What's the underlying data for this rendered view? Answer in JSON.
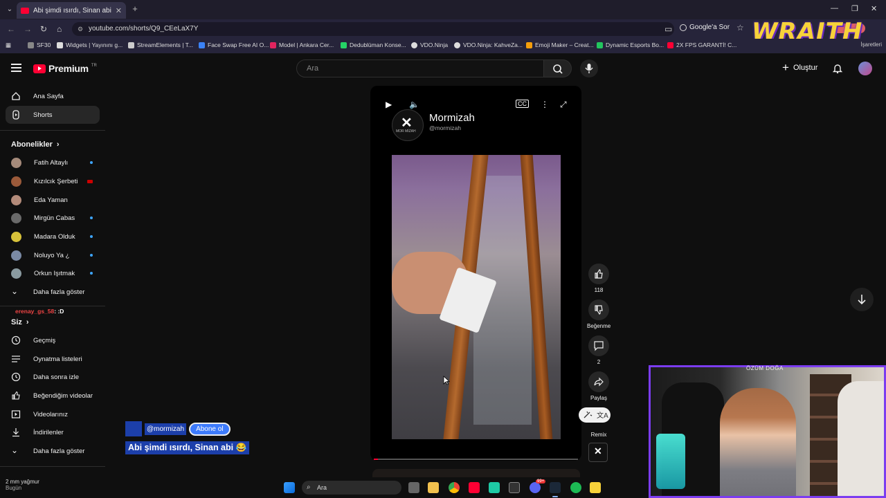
{
  "browser": {
    "tab_title": "Abi şimdi ısırdı, Sinan abi 😂 -",
    "url": "youtube.com/shorts/Q9_CEeLaX7Y",
    "google_sor": "Google'a Sor",
    "bookmarks": [
      {
        "label": "SF30",
        "color": "#888888"
      },
      {
        "label": "Widgets | Yayınını g...",
        "color": "#dddddd"
      },
      {
        "label": "StreamElements | T...",
        "color": "#cccccc"
      },
      {
        "label": "Face Swap Free AI O...",
        "color": "#3b82f6"
      },
      {
        "label": "Model | Ankara Cer...",
        "color": "#e0245e"
      },
      {
        "label": "Dedublüman Konse...",
        "color": "#25d366"
      },
      {
        "label": "VDO.Ninja",
        "color": "#dddddd"
      },
      {
        "label": "VDO.Ninja: KahveZa...",
        "color": "#dddddd"
      },
      {
        "label": "Emoji Maker – Creat...",
        "color": "#f59e0b"
      },
      {
        "label": "Dynamic Esports Bo...",
        "color": "#22c55e"
      },
      {
        "label": "2X FPS GARANTİ! C...",
        "color": "#ff0033"
      }
    ],
    "bookmarks_right": "İşaretleri",
    "overlay_logo": "WRAITH"
  },
  "header": {
    "brand": "Premium",
    "brand_sup": "TR",
    "search_placeholder": "Ara",
    "create_label": "Oluştur"
  },
  "sidebar": {
    "main": [
      {
        "label": "Ana Sayfa",
        "icon": "home-icon"
      },
      {
        "label": "Shorts",
        "icon": "shorts-icon",
        "active": true
      }
    ],
    "subscriptions_title": "Abonelikler",
    "subscriptions": [
      {
        "label": "Fatih Altaylı",
        "color": "#a58a7a",
        "indicator": "new"
      },
      {
        "label": "Kızılcık Şerbeti",
        "color": "#9b5a3a",
        "indicator": "live"
      },
      {
        "label": "Eda Yaman",
        "color": "#b38b7a",
        "indicator": "none"
      },
      {
        "label": "Mirgün Cabas",
        "color": "#6a6a6a",
        "indicator": "new"
      },
      {
        "label": "Madara Olduk",
        "color": "#d8c23a",
        "indicator": "new"
      },
      {
        "label": "Noluyo Ya ¿",
        "color": "#7a8aa5",
        "indicator": "new"
      },
      {
        "label": "Orkun Işıtmak",
        "color": "#8a9aa0",
        "indicator": "new"
      }
    ],
    "show_more": "Daha fazla göster",
    "chat_user": "erenay_gs_58",
    "chat_msg": ": :D",
    "you_title": "Siz",
    "you_items": [
      {
        "label": "Geçmiş",
        "icon": "history-icon"
      },
      {
        "label": "Oynatma listeleri",
        "icon": "playlist-icon"
      },
      {
        "label": "Daha sonra izle",
        "icon": "clock-icon"
      },
      {
        "label": "Beğendiğim videolar",
        "icon": "like-icon"
      },
      {
        "label": "Videolarınız",
        "icon": "video-icon"
      },
      {
        "label": "İndirilenler",
        "icon": "download-icon"
      }
    ],
    "show_more2": "Daha fazla göster"
  },
  "short": {
    "channel_name": "Mormizah",
    "channel_handle": "@mormizah",
    "logo_text": "MOR MİZAH",
    "likes": "118",
    "dislike_label": "Beğenme",
    "comments": "2",
    "share_label": "Paylaş",
    "remix_label": "Remix",
    "progress_fraction": 0.02
  },
  "overlay": {
    "handle": "@mormizah",
    "subscribe": "Abone ol",
    "title": "Abi şimdi ısırdı, Sinan abi 😂"
  },
  "webcam": {
    "label": "ÖZÜM DOĞA"
  },
  "weather": {
    "line1": "2 mm yağmur",
    "line2": "Bugün"
  },
  "taskbar": {
    "search_label": "Ara",
    "badge": "99+"
  },
  "colors": {
    "yt_red": "#ff0033",
    "accent_purple": "#7b3cf0",
    "wraith_yellow": "#f7d23a"
  }
}
